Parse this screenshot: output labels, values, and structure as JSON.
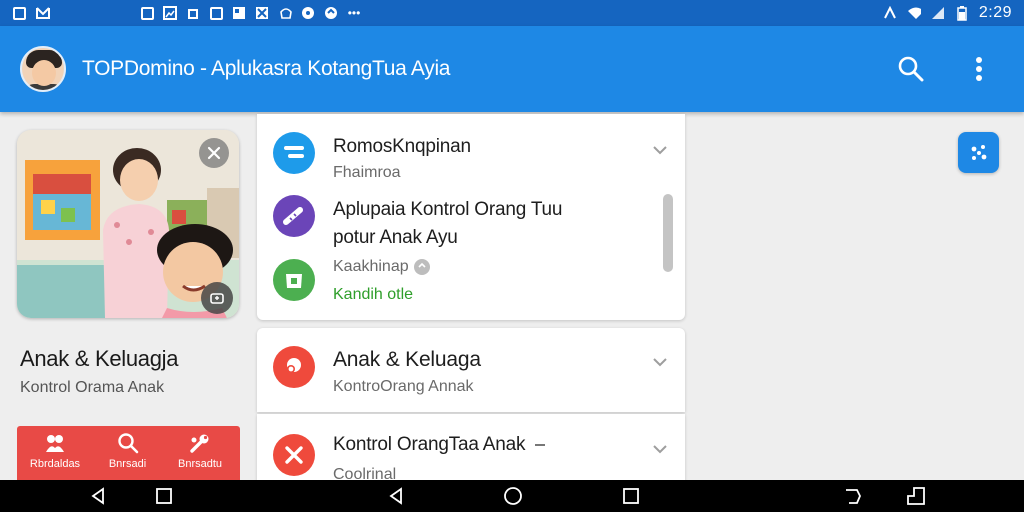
{
  "status_bar": {
    "time": "2:29",
    "left_icons": [
      "photo-icon",
      "gmail-icon"
    ],
    "mid_icons": [
      "message-icon",
      "image-icon",
      "sync-icon",
      "calendar-icon",
      "news-icon",
      "app-icon",
      "shield-icon",
      "location-icon",
      "more-icon"
    ],
    "right_icons": [
      "nfc-icon",
      "wifi-icon",
      "signal-icon",
      "battery-icon"
    ]
  },
  "app_bar": {
    "title": "TOPDomino - Aplukasra KotangTua Ayia",
    "color": "#1e88e5"
  },
  "left_panel": {
    "title": "Anak & Keluagja",
    "subtitle": "Kontrol Orama Anak",
    "actions": [
      {
        "icon": "group-icon",
        "label": "Rbrdaldas"
      },
      {
        "icon": "search-icon",
        "label": "Bnrsadi"
      },
      {
        "icon": "tools-icon",
        "label": "Bnrsadtu"
      }
    ],
    "accent": "#e84a46"
  },
  "cards": {
    "card1": {
      "row1": {
        "title": "RomosKnqpinan",
        "subtitle": "Fhaimroa",
        "icon_color": "#1e9bea"
      },
      "row2": {
        "title_line1": "Aplupaia Kontrol Orang Tuu",
        "title_line2": "potur Anak Ayu",
        "icon_color": "#6b45b8"
      },
      "row3": {
        "title": "Kaakhinap",
        "status": "Kandih otle",
        "icon_color": "#4caf50"
      }
    },
    "card2": {
      "title": "Anak & Keluaga",
      "subtitle": "KontroOrang Annak",
      "icon_color": "#ef4a3c"
    },
    "card3": {
      "title": "Kontrol OrangTaa Anak",
      "subtitle": "Coolrinal",
      "icon_color": "#ef4a3c"
    }
  }
}
